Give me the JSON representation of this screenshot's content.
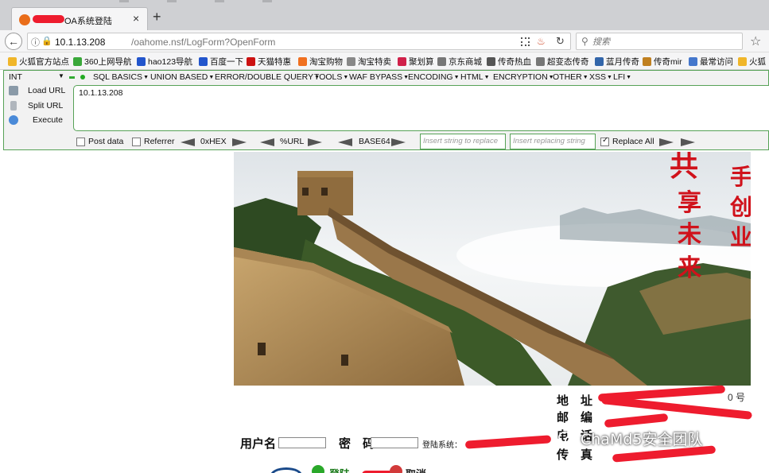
{
  "tab": {
    "title": "OA系统登陆",
    "close_icon": "×",
    "new_tab_icon": "+"
  },
  "nav": {
    "url_host": "10.1.13.208",
    "url_path": "/oahome.nsf/LogForm?OpenForm",
    "search_placeholder": "搜索"
  },
  "bookmarks": [
    {
      "label": "火狐官方站点",
      "color": "#f0b62a"
    },
    {
      "label": "360上网导航",
      "color": "#3aa83a"
    },
    {
      "label": "hao123导航",
      "color": "#2255cc"
    },
    {
      "label": "百度一下",
      "color": "#2255cc"
    },
    {
      "label": "天猫特惠",
      "color": "#cc1111"
    },
    {
      "label": "淘宝购物",
      "color": "#f07020"
    },
    {
      "label": "淘宝特卖",
      "color": "#888888"
    },
    {
      "label": "聚划算",
      "color": "#d0204a"
    },
    {
      "label": "京东商城",
      "color": "#777777"
    },
    {
      "label": "传奇热血",
      "color": "#555555"
    },
    {
      "label": "超变态传奇",
      "color": "#777777"
    },
    {
      "label": "蓝月传奇",
      "color": "#3366aa"
    },
    {
      "label": "传奇mir",
      "color": "#c08020"
    },
    {
      "label": "最常访问",
      "color": "#4477cc"
    },
    {
      "label": "火狐",
      "color": "#f0b62a"
    }
  ],
  "hackbar": {
    "selector": "INT",
    "menus": [
      "SQL BASICS",
      "UNION BASED",
      "ERROR/DOUBLE QUERY",
      "TOOLS",
      "WAF BYPASS",
      "ENCODING",
      "HTML",
      "ENCRYPTION",
      "OTHER",
      "XSS",
      "LFI"
    ],
    "load_url": "Load URL",
    "split_url": "Split URL",
    "execute": "Execute",
    "url_value": "10.1.13.208",
    "post_data": "Post data",
    "referrer": "Referrer",
    "hex": "0xHEX",
    "url_enc": "%URL",
    "base64": "BASE64",
    "replace_placeholder": "Insert string to replace",
    "replacing_placeholder": "Insert replacing string",
    "replace_all": "Replace All",
    "post_checked": false,
    "referrer_checked": false,
    "replace_all_checked": true
  },
  "banner": {
    "slogan_left": [
      "共",
      "享",
      "未",
      "来"
    ],
    "slogan_right": [
      "手",
      "创",
      "业"
    ]
  },
  "contact": {
    "address": "地　址",
    "postcode": "邮　编",
    "phone": "电　话",
    "fax": "传　真",
    "address_tail": "0 号"
  },
  "login": {
    "username_label": "用户名",
    "password_label": "密　码",
    "system_label": "登陆系统：",
    "login_button": "登陆",
    "cancel_button": "取消"
  },
  "watermark": "ChaMd5安全团队"
}
